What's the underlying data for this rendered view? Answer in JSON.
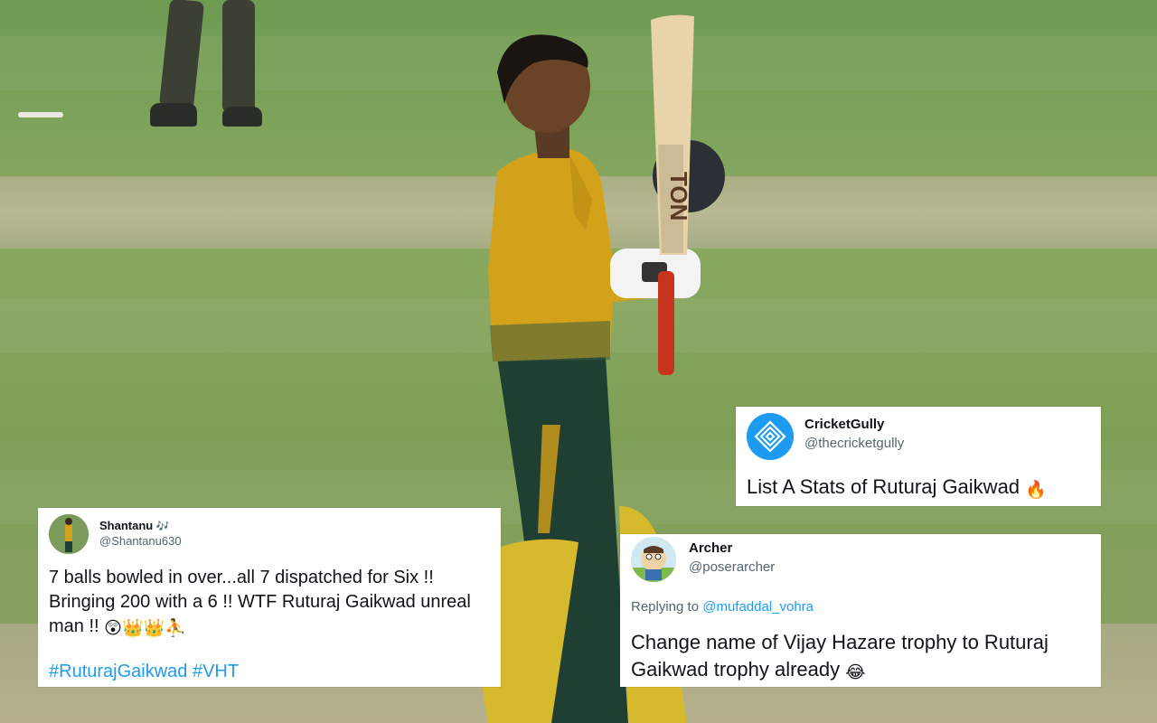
{
  "tweets": {
    "cricketgully": {
      "name": "CricketGully",
      "handle": "@thecricketgully",
      "text": "List A Stats of Ruturaj Gaikwad",
      "emoji": "🔥",
      "avatar_color": "#1d9bf0"
    },
    "shantanu": {
      "name": "Shantanu",
      "name_emoji": "🎶",
      "handle": "@Shantanu630",
      "line1": "7 balls bowled in over...all 7 dispatched for Six !!",
      "line2": "Bringing 200 with a 6 !! WTF Ruturaj Gaikwad unreal",
      "line3": "man !!",
      "line3_emojis": "😲👑👑⛹️",
      "hashtags": "#RuturajGaikwad #VHT"
    },
    "archer": {
      "name": "Archer",
      "handle": "@poserarcher",
      "replying_prefix": "Replying to",
      "replying_to": "@mufaddal_vohra",
      "line1": "Change name of Vijay Hazare trophy to Ruturaj",
      "line2": "Gaikwad trophy already",
      "emoji": "😂"
    }
  },
  "colors": {
    "link": "#1d9bf0",
    "handle": "#536471",
    "jersey": "#d4a21a",
    "trousers": "#1f3f33"
  }
}
